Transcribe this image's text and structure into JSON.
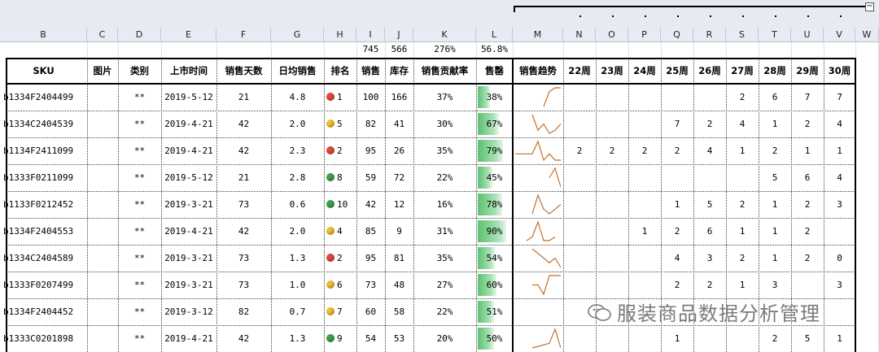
{
  "columns": [
    "B",
    "C",
    "D",
    "E",
    "F",
    "G",
    "H",
    "I",
    "J",
    "K",
    "L",
    "M",
    "N",
    "O",
    "P",
    "Q",
    "R",
    "S",
    "T",
    "U",
    "V",
    "W"
  ],
  "totals": {
    "I": "745",
    "J": "566",
    "K": "276%",
    "L": "56.8%"
  },
  "headers": {
    "sku": "SKU",
    "image": "图片",
    "category": "类别",
    "launch": "上市时间",
    "days": "销售天数",
    "daily": "日均销售",
    "rank": "排名",
    "sales": "销售",
    "stock": "库存",
    "contrib": "销售贡献率",
    "sellthru": "售罄",
    "trend": "销售趋势",
    "weeks": [
      "22周",
      "23周",
      "24周",
      "25周",
      "26周",
      "27周",
      "28周",
      "29周",
      "30周"
    ]
  },
  "colors": {
    "red": "#e24b3c",
    "yellow": "#f1c232",
    "green": "#3fa34d",
    "bar": "#5cc171",
    "spark": "#c0702a"
  },
  "rows": [
    {
      "sku": "b1334F2404499",
      "cat": "**",
      "date": "2019-5-12",
      "days": "21",
      "daily": "4.8",
      "rank": "1",
      "icon": "red",
      "sales": "100",
      "stock": "166",
      "contrib": "37%",
      "st": "38%",
      "stv": 0.38,
      "weeks": [
        "",
        "",
        "",
        "",
        "",
        "2",
        "6",
        "7",
        "7"
      ]
    },
    {
      "sku": "b1334C2404539",
      "cat": "**",
      "date": "2019-4-21",
      "days": "42",
      "daily": "2.0",
      "rank": "5",
      "icon": "yellow",
      "sales": "82",
      "stock": "41",
      "contrib": "30%",
      "st": "67%",
      "stv": 0.67,
      "weeks": [
        "",
        "",
        "",
        "7",
        "2",
        "4",
        "1",
        "2",
        "4"
      ]
    },
    {
      "sku": "b1134F2411099",
      "cat": "**",
      "date": "2019-4-21",
      "days": "42",
      "daily": "2.3",
      "rank": "2",
      "icon": "red",
      "sales": "95",
      "stock": "26",
      "contrib": "35%",
      "st": "79%",
      "stv": 0.79,
      "weeks": [
        "2",
        "2",
        "2",
        "2",
        "4",
        "1",
        "2",
        "1",
        "1"
      ]
    },
    {
      "sku": "b1333F0211099",
      "cat": "**",
      "date": "2019-5-12",
      "days": "21",
      "daily": "2.8",
      "rank": "8",
      "icon": "green",
      "sales": "59",
      "stock": "72",
      "contrib": "22%",
      "st": "45%",
      "stv": 0.45,
      "weeks": [
        "",
        "",
        "",
        "",
        "",
        "",
        "5",
        "6",
        "4"
      ]
    },
    {
      "sku": "b1133F0212452",
      "cat": "**",
      "date": "2019-3-21",
      "days": "73",
      "daily": "0.6",
      "rank": "10",
      "icon": "green",
      "sales": "42",
      "stock": "12",
      "contrib": "16%",
      "st": "78%",
      "stv": 0.78,
      "weeks": [
        "",
        "",
        "",
        "1",
        "5",
        "2",
        "1",
        "2",
        "3"
      ]
    },
    {
      "sku": "b1334F2404553",
      "cat": "**",
      "date": "2019-4-21",
      "days": "42",
      "daily": "2.0",
      "rank": "4",
      "icon": "yellow",
      "sales": "85",
      "stock": "9",
      "contrib": "31%",
      "st": "90%",
      "stv": 0.9,
      "weeks": [
        "",
        "",
        "1",
        "2",
        "6",
        "1",
        "1",
        "2",
        ""
      ]
    },
    {
      "sku": "b1334C2404589",
      "cat": "**",
      "date": "2019-3-21",
      "days": "73",
      "daily": "1.3",
      "rank": "2",
      "icon": "red",
      "sales": "95",
      "stock": "81",
      "contrib": "35%",
      "st": "54%",
      "stv": 0.54,
      "weeks": [
        "",
        "",
        "",
        "4",
        "3",
        "2",
        "1",
        "2",
        "0"
      ]
    },
    {
      "sku": "b1333F0207499",
      "cat": "**",
      "date": "2019-3-21",
      "days": "73",
      "daily": "1.0",
      "rank": "6",
      "icon": "yellow",
      "sales": "73",
      "stock": "48",
      "contrib": "27%",
      "st": "60%",
      "stv": 0.6,
      "weeks": [
        "",
        "",
        "",
        "2",
        "2",
        "1",
        "3",
        "",
        "3"
      ]
    },
    {
      "sku": "b1334F2404452",
      "cat": "**",
      "date": "2019-3-12",
      "days": "82",
      "daily": "0.7",
      "rank": "7",
      "icon": "yellow",
      "sales": "60",
      "stock": "58",
      "contrib": "22%",
      "st": "51%",
      "stv": 0.51,
      "weeks": [
        "",
        "",
        "",
        "",
        "",
        "",
        "",
        "",
        ""
      ]
    },
    {
      "sku": "b1333C0201898",
      "cat": "**",
      "date": "2019-4-21",
      "days": "42",
      "daily": "1.3",
      "rank": "9",
      "icon": "green",
      "sales": "54",
      "stock": "53",
      "contrib": "20%",
      "st": "50%",
      "stv": 0.5,
      "weeks": [
        "",
        "",
        "",
        "1",
        "",
        "",
        "2",
        "5",
        "1"
      ]
    }
  ],
  "watermark": "服装商品数据分析管理"
}
